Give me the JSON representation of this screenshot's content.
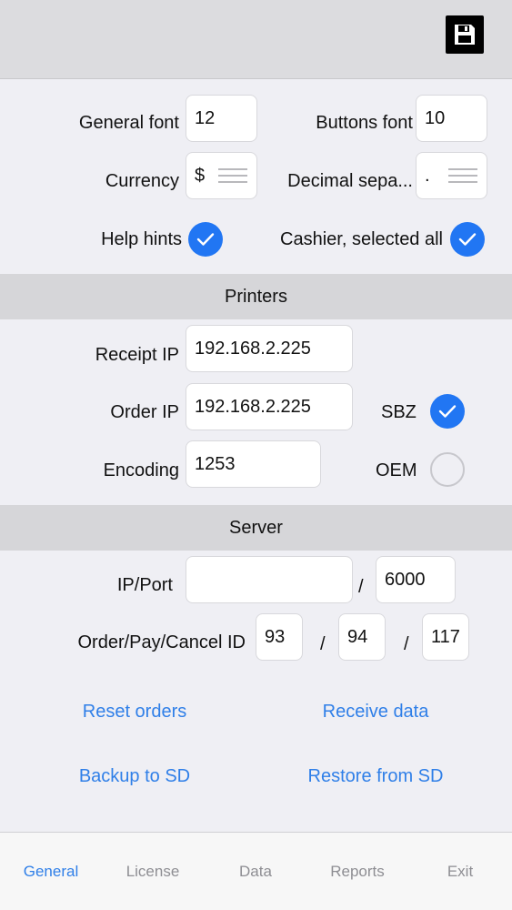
{
  "general": {
    "general_font_label": "General font",
    "general_font_value": "12",
    "buttons_font_label": "Buttons font",
    "buttons_font_value": "10",
    "currency_label": "Currency",
    "currency_value": "$",
    "decimal_label": "Decimal sepa...",
    "decimal_value": ".",
    "help_hints_label": "Help hints",
    "help_hints_checked": true,
    "cashier_label": "Cashier, selected all",
    "cashier_checked": true
  },
  "printers": {
    "header": "Printers",
    "receipt_ip_label": "Receipt IP",
    "receipt_ip_value": "192.168.2.225",
    "order_ip_label": "Order IP",
    "order_ip_value": "192.168.2.225",
    "sbz_label": "SBZ",
    "sbz_checked": true,
    "encoding_label": "Encoding",
    "encoding_value": "1253",
    "oem_label": "OEM",
    "oem_checked": false
  },
  "server": {
    "header": "Server",
    "ip_port_label": "IP/Port",
    "ip_value": "",
    "port_value": "6000",
    "slash": "/",
    "ids_label": "Order/Pay/Cancel ID",
    "order_id": "93",
    "pay_id": "94",
    "cancel_id": "117"
  },
  "actions": {
    "reset_orders": "Reset orders",
    "receive_data": "Receive data",
    "backup": "Backup to SD",
    "restore": "Restore from SD"
  },
  "tabs": [
    {
      "label": "General",
      "active": true
    },
    {
      "label": "License",
      "active": false
    },
    {
      "label": "Data",
      "active": false
    },
    {
      "label": "Reports",
      "active": false
    },
    {
      "label": "Exit",
      "active": false
    }
  ],
  "colors": {
    "accent": "#2f7fe8",
    "check_fill": "#2176f3",
    "section_bg": "#d6d6d9"
  }
}
